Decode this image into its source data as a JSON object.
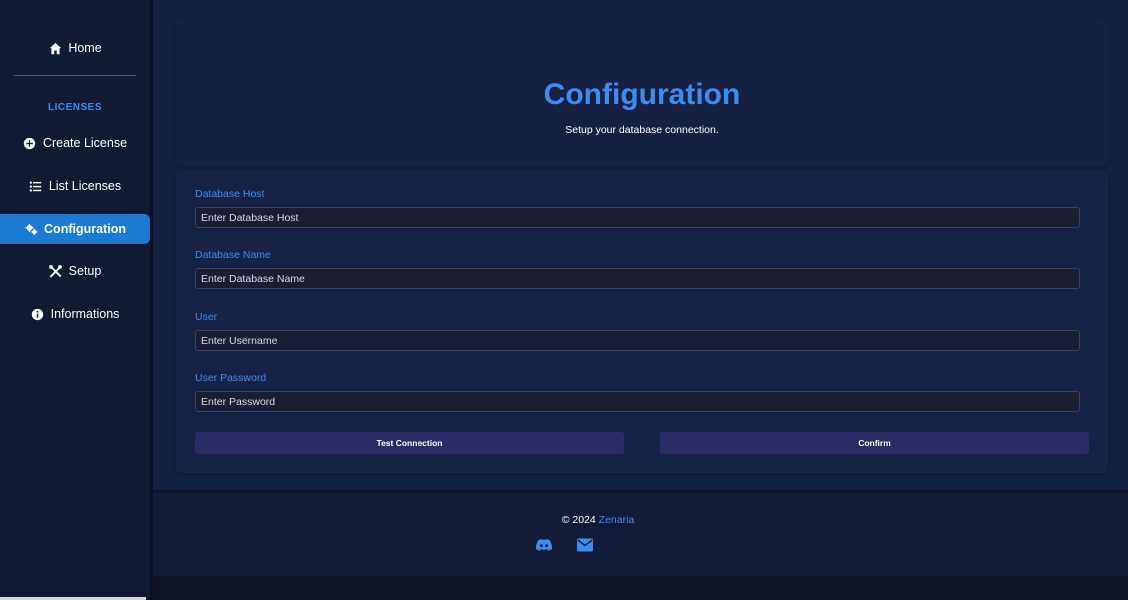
{
  "sidebar": {
    "home": "Home",
    "section": "LICENSES",
    "items": [
      {
        "label": "Create License",
        "icon": "plus-circle-icon"
      },
      {
        "label": "List Licenses",
        "icon": "list-icon"
      },
      {
        "label": "Configuration",
        "icon": "cogs-icon"
      },
      {
        "label": "Setup",
        "icon": "tools-icon"
      },
      {
        "label": "Informations",
        "icon": "info-icon"
      }
    ]
  },
  "header": {
    "title": "Configuration",
    "subtitle": "Setup your database connection."
  },
  "form": {
    "db_host_label": "Database Host",
    "db_host_placeholder": "Enter Database Host",
    "db_name_label": "Database Name",
    "db_name_placeholder": "Enter Database Name",
    "user_label": "User",
    "user_placeholder": "Enter Username",
    "password_label": "User Password",
    "password_placeholder": "Enter Password",
    "test_button": "Test Connection",
    "confirm_button": "Confirm"
  },
  "footer": {
    "copyright": "© 2024",
    "brand": "Zenaria"
  },
  "colors": {
    "accent": "#3d8df0",
    "active_nav": "#1a7ad4",
    "button": "#2b2b66"
  }
}
